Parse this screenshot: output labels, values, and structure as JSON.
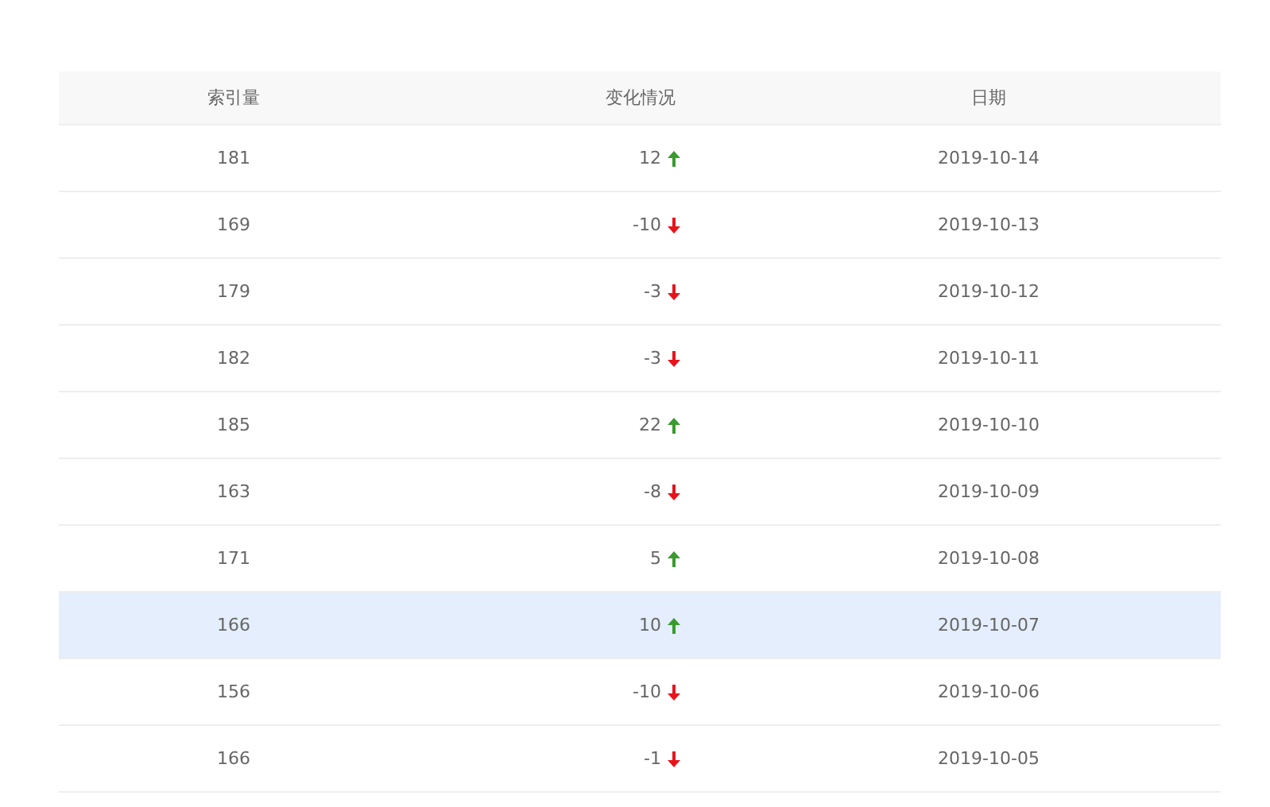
{
  "table": {
    "columns": [
      "索引量",
      "变化情况",
      "日期"
    ],
    "rows": [
      {
        "index": "181",
        "change": "12",
        "kind": "up",
        "date": "2019-10-14",
        "selected": false
      },
      {
        "index": "169",
        "change": "-10",
        "kind": "down",
        "date": "2019-10-13",
        "selected": false
      },
      {
        "index": "179",
        "change": "-3",
        "kind": "down",
        "date": "2019-10-12",
        "selected": false
      },
      {
        "index": "182",
        "change": "-3",
        "kind": "down",
        "date": "2019-10-11",
        "selected": false
      },
      {
        "index": "185",
        "change": "22",
        "kind": "up",
        "date": "2019-10-10",
        "selected": false
      },
      {
        "index": "163",
        "change": "-8",
        "kind": "down",
        "date": "2019-10-09",
        "selected": false
      },
      {
        "index": "171",
        "change": "5",
        "kind": "up",
        "date": "2019-10-08",
        "selected": false
      },
      {
        "index": "166",
        "change": "10",
        "kind": "up",
        "date": "2019-10-07",
        "selected": true
      },
      {
        "index": "156",
        "change": "-10",
        "kind": "down",
        "date": "2019-10-06",
        "selected": false
      },
      {
        "index": "166",
        "change": "-1",
        "kind": "down",
        "date": "2019-10-05",
        "selected": false
      }
    ]
  }
}
